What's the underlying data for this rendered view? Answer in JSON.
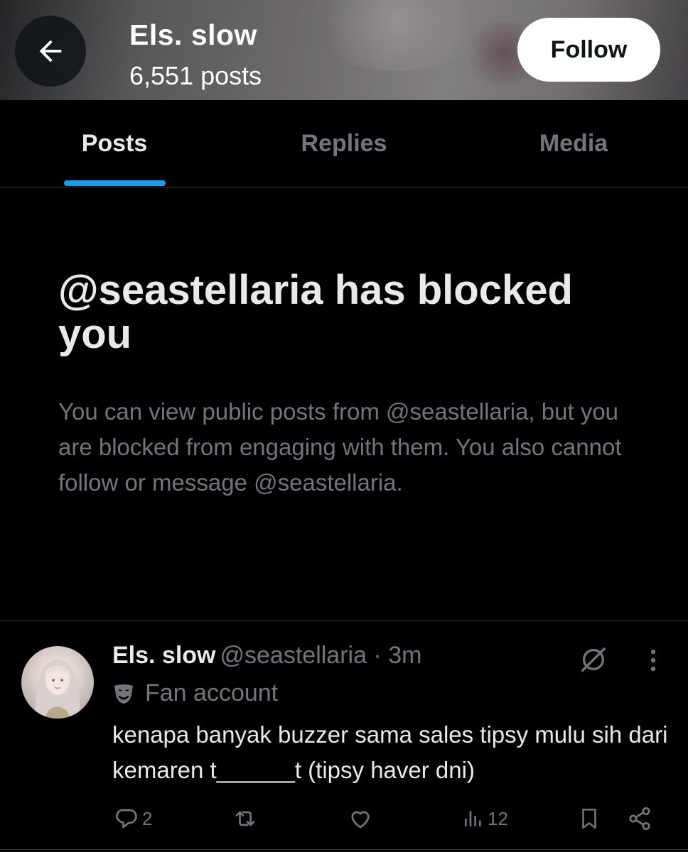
{
  "header": {
    "name": "Els. slow",
    "posts_count": "6,551 posts",
    "follow_label": "Follow"
  },
  "tabs": [
    {
      "label": "Posts",
      "active": true
    },
    {
      "label": "Replies",
      "active": false
    },
    {
      "label": "Media",
      "active": false
    }
  ],
  "blocked": {
    "title": "@seastellaria has blocked you",
    "description": "You can view public posts from @seastellaria, but you are blocked from engaging with them. You also cannot follow or message @seastellaria."
  },
  "post": {
    "author_name": "Els. slow",
    "handle_time": "@seastellaria · 3m",
    "label": "Fan account",
    "text": "kenapa banyak buzzer sama sales tipsy mulu sih dari kemaren t______t (tipsy haver dni)",
    "actions": {
      "replies": "2",
      "reposts": "",
      "likes": "",
      "views": "12"
    }
  },
  "colors": {
    "accent": "#1d9bf0",
    "background": "#000000",
    "muted_text": "#71767b"
  }
}
